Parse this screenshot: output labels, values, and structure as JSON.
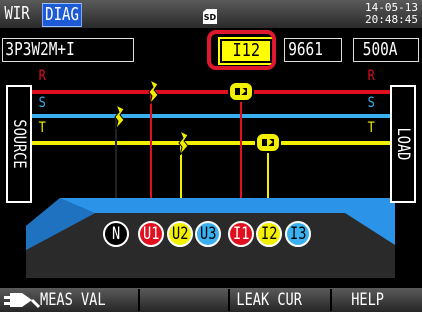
{
  "tabs": [
    {
      "label": "WIR",
      "active": false
    },
    {
      "label": "DIAG",
      "active": true
    }
  ],
  "sd_label": "SD",
  "clock": {
    "date": "14-05-13",
    "time": "20:48:45"
  },
  "info": {
    "wiring": "3P3W2M+I",
    "selected_channel": "I12",
    "sensor_model": "9661",
    "range": "500A"
  },
  "plates": {
    "source": "SOURCE",
    "load": "LOAD"
  },
  "phase_labels": {
    "r": "R",
    "s": "S",
    "t": "T"
  },
  "terminals": [
    {
      "label": "N",
      "style": "outline"
    },
    {
      "label": "U1",
      "style": "red"
    },
    {
      "label": "U2",
      "style": "yellow"
    },
    {
      "label": "U3",
      "style": "blue"
    },
    {
      "label": "I1",
      "style": "red"
    },
    {
      "label": "I2",
      "style": "yellow"
    },
    {
      "label": "I3",
      "style": "blue"
    }
  ],
  "function_keys": [
    {
      "label": "MEAS VAL",
      "icon": "meter-plug-icon"
    },
    {
      "label": ""
    },
    {
      "label": "LEAK CUR"
    },
    {
      "label": "HELP"
    }
  ],
  "colors": {
    "r_phase": "#e01020",
    "s_phase": "#3ab0f0",
    "t_phase": "#f2f000",
    "active_tab": "#1d5ad6",
    "highlight_frame": "#e0182d",
    "instrument_body": "#2a2a2a",
    "instrument_side": "#2b93e8"
  }
}
